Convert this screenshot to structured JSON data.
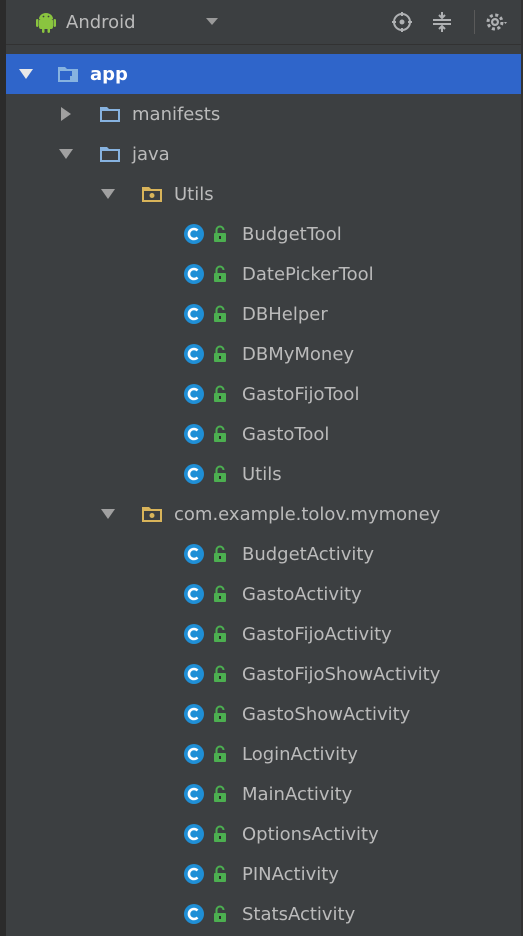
{
  "toolbar": {
    "view_label": "Android",
    "icons": [
      "android-icon",
      "target-icon",
      "collapse-icon",
      "gear-icon"
    ]
  },
  "tree": {
    "app": {
      "label": "app",
      "icon": "module-folder-icon",
      "expanded": true
    },
    "manifests": {
      "label": "manifests",
      "icon": "folder-icon",
      "expanded": false
    },
    "java": {
      "label": "java",
      "icon": "folder-icon",
      "expanded": true
    },
    "packages": [
      {
        "label": "Utils",
        "icon": "package-icon",
        "classes": [
          "BudgetTool",
          "DatePickerTool",
          "DBHelper",
          "DBMyMoney",
          "GastoFijoTool",
          "GastoTool",
          "Utils"
        ]
      },
      {
        "label": "com.example.tolov.mymoney",
        "icon": "package-icon",
        "classes": [
          "BudgetActivity",
          "GastoActivity",
          "GastoFijoActivity",
          "GastoFijoShowActivity",
          "GastoShowActivity",
          "LoginActivity",
          "MainActivity",
          "OptionsActivity",
          "PINActivity",
          "StatsActivity"
        ]
      }
    ]
  },
  "colors": {
    "background": "#3c3f41",
    "selection": "#2f65ca",
    "class_badge": "#1f8fd6",
    "lock_icon": "#4caf50",
    "folder": "#87b3e0",
    "package_folder": "#d9b45a"
  }
}
